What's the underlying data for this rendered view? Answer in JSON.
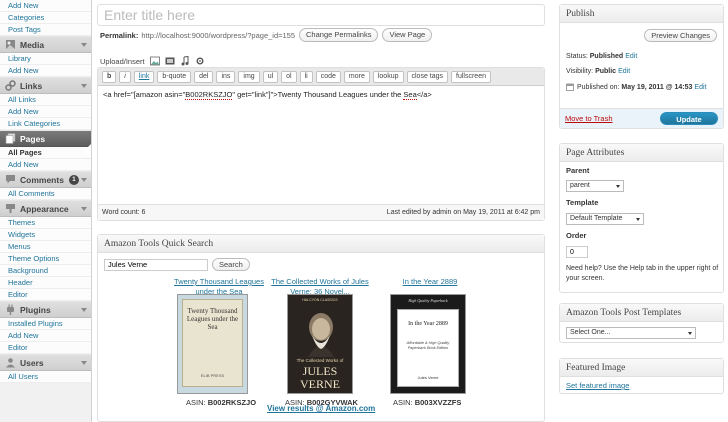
{
  "sidebar": {
    "top_items": [
      "Add New",
      "Categories",
      "Post Tags"
    ],
    "sections": [
      {
        "label": "Media",
        "icon": "media-icon",
        "items": [
          "Library",
          "Add New"
        ]
      },
      {
        "label": "Links",
        "icon": "links-icon",
        "items": [
          "All Links",
          "Add New",
          "Link Categories"
        ]
      },
      {
        "label": "Pages",
        "icon": "pages-icon",
        "active": true,
        "items": [
          "All Pages",
          "Add New"
        ]
      },
      {
        "label": "Comments",
        "icon": "comments-icon",
        "badge": "1",
        "items": [
          "All Comments"
        ]
      },
      {
        "label": "Appearance",
        "icon": "appearance-icon",
        "items": [
          "Themes",
          "Widgets",
          "Menus",
          "Theme Options",
          "Background",
          "Header",
          "Editor"
        ]
      },
      {
        "label": "Plugins",
        "icon": "plugins-icon",
        "items": [
          "Installed Plugins",
          "Add New",
          "Editor"
        ]
      },
      {
        "label": "Users",
        "icon": "users-icon",
        "items": [
          "All Users"
        ]
      }
    ]
  },
  "editor": {
    "title_placeholder": "Enter title here",
    "permalink_label": "Permalink:",
    "permalink_url": "http://localhost:9000/wordpress/?page_id=155",
    "change_permalinks": "Change Permalinks",
    "view_page": "View Page",
    "upload_label": "Upload/Insert",
    "quicktags": [
      "b",
      "i",
      "link",
      "b-quote",
      "del",
      "ins",
      "img",
      "ul",
      "ol",
      "li",
      "code",
      "more",
      "lookup",
      "close tags",
      "fullscreen"
    ],
    "content_parts": {
      "pre": "<a href=\"[amazon asin=\"",
      "asin": "B002RKSZJO",
      "mid": "\" get=\"link\"]\">Twenty Thousand Leagues under the ",
      "word": "Sea",
      "post": "</a>"
    },
    "word_count": "Word count: 6",
    "last_edited": "Last edited by admin on May 19, 2011 at 6:42 pm"
  },
  "amazon": {
    "title": "Amazon Tools Quick Search",
    "search_value": "Jules Verne",
    "search_button": "Search",
    "asin_label": "ASIN:",
    "results": [
      {
        "title": "Twenty Thousand Leagues under the Sea",
        "asin": "B002RKSZJO",
        "cover_title": "Twenty Thousand Leagues under the Sea",
        "cover_publisher": "ELIB PRESS"
      },
      {
        "title": "The Collected Works of Jules Verne: 36 Novel...",
        "asin": "B002GYVWAK",
        "cover_series": "HALCYON CLASSICS",
        "cover_sub": "The Collected Works of",
        "cover_author_a": "JULES",
        "cover_author_b": "VERNE"
      },
      {
        "title": "In the Year 2889",
        "asin": "B003XVZZFS",
        "cover_header": "High Quality Paperback",
        "cover_title": "In the Year 2889",
        "cover_note": "Affordable & High Quality Paperback Book Edition",
        "cover_author": "Jules Verne"
      }
    ],
    "view_results": "View results @ Amazon.com"
  },
  "publish": {
    "title": "Publish",
    "preview": "Preview Changes",
    "status_label": "Status:",
    "status_value": "Published",
    "visibility_label": "Visibility:",
    "visibility_value": "Public",
    "published_label": "Published on:",
    "published_value": "May 19, 2011 @ 14:53",
    "edit": "Edit",
    "trash": "Move to Trash",
    "update": "Update"
  },
  "attributes": {
    "title": "Page Attributes",
    "parent_label": "Parent",
    "parent_value": "parent",
    "template_label": "Template",
    "template_value": "Default Template",
    "order_label": "Order",
    "order_value": "0",
    "help": "Need help? Use the Help tab in the upper right of your screen."
  },
  "post_templates": {
    "title": "Amazon Tools Post Templates",
    "select_value": "Select One..."
  },
  "featured": {
    "title": "Featured Image",
    "link": "Set featured image"
  },
  "colors": {
    "link": "#21759b",
    "trash": "#bc0b0b",
    "update": "#21759b",
    "active_menu": "#6d6d6d"
  }
}
